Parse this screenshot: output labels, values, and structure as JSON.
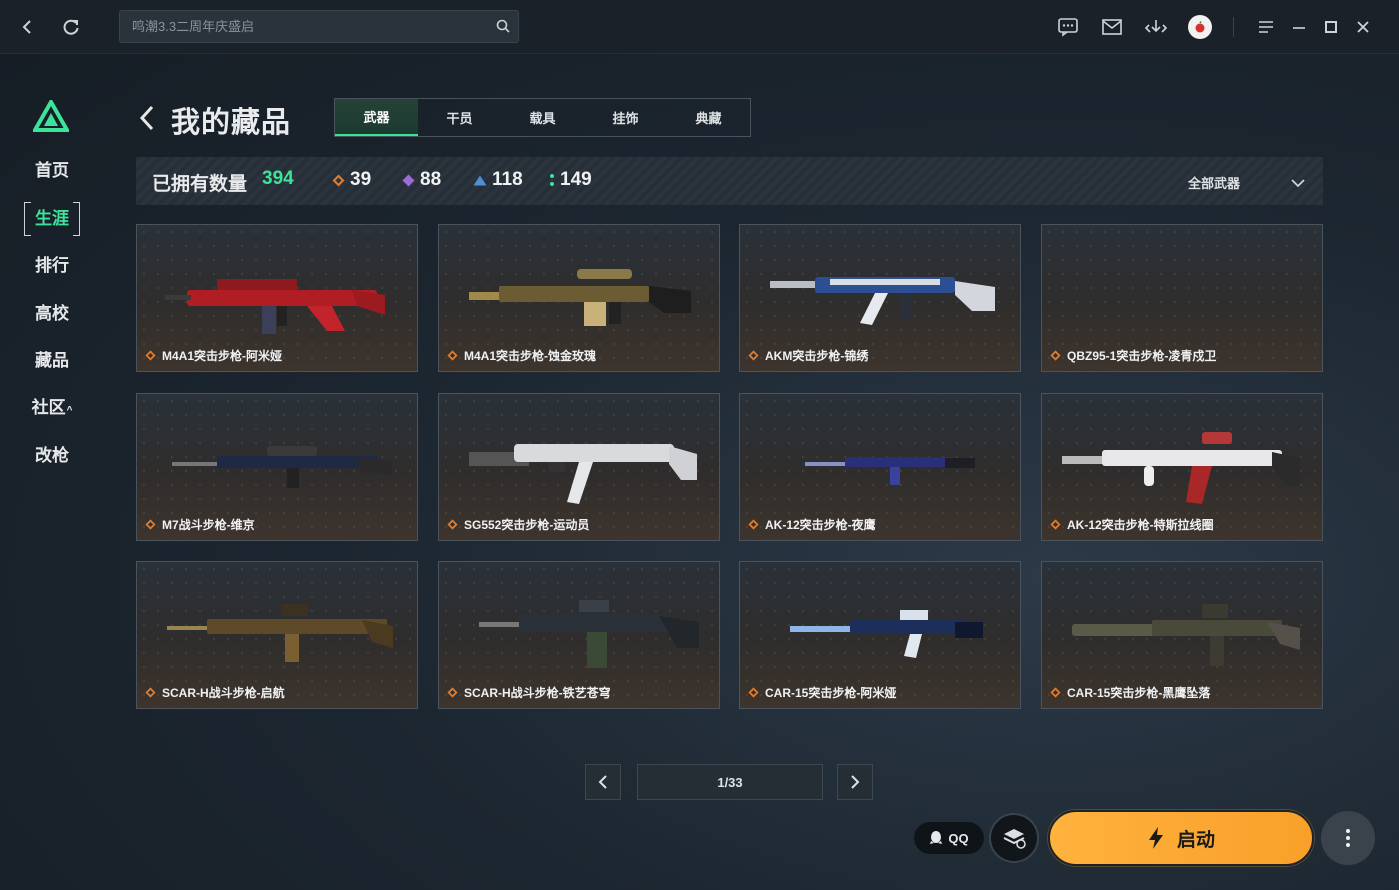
{
  "search": {
    "placeholder": "鸣潮3.3二周年庆盛启"
  },
  "sidebar": {
    "items": [
      {
        "label": "首页"
      },
      {
        "label": "生涯"
      },
      {
        "label": "排行"
      },
      {
        "label": "高校"
      },
      {
        "label": "藏品"
      },
      {
        "label": "社区"
      },
      {
        "label": "改枪"
      }
    ],
    "active_index": 1
  },
  "header": {
    "title": "我的藏品",
    "tabs": [
      "武器",
      "干员",
      "载具",
      "挂饰",
      "典藏"
    ],
    "active_tab": 0
  },
  "stats": {
    "owned_label": "已拥有数量",
    "owned_count": "394",
    "rarities": [
      {
        "count": "39",
        "color": "#e07b2c"
      },
      {
        "count": "88",
        "color": "#9b6bd6"
      },
      {
        "count": "118",
        "color": "#4f8fd8"
      },
      {
        "count": "149",
        "color": "#3ee39a"
      }
    ],
    "filter_label": "全部武器"
  },
  "cards": [
    {
      "name": "M4A1突击步枪-阿米娅"
    },
    {
      "name": "M4A1突击步枪-蚀金玫瑰"
    },
    {
      "name": "AKM突击步枪-锦绣"
    },
    {
      "name": "QBZ95-1突击步枪-凌青戍卫"
    },
    {
      "name": "M7战斗步枪-维京"
    },
    {
      "name": "SG552突击步枪-运动员"
    },
    {
      "name": "AK-12突击步枪-夜鹰"
    },
    {
      "name": "AK-12突击步枪-特斯拉线圈"
    },
    {
      "name": "SCAR-H战斗步枪-启航"
    },
    {
      "name": "SCAR-H战斗步枪-铁艺苍穹"
    },
    {
      "name": "CAR-15突击步枪-阿米娅"
    },
    {
      "name": "CAR-15突击步枪-黑鹰坠落"
    }
  ],
  "pagination": {
    "current": "1/33"
  },
  "launcher": {
    "qq_label": "QQ",
    "launch_label": "启动"
  },
  "colors": {
    "accent": "#3ee39a",
    "launch": "#ffb23d",
    "rarity_gold": "#e07b2c"
  }
}
